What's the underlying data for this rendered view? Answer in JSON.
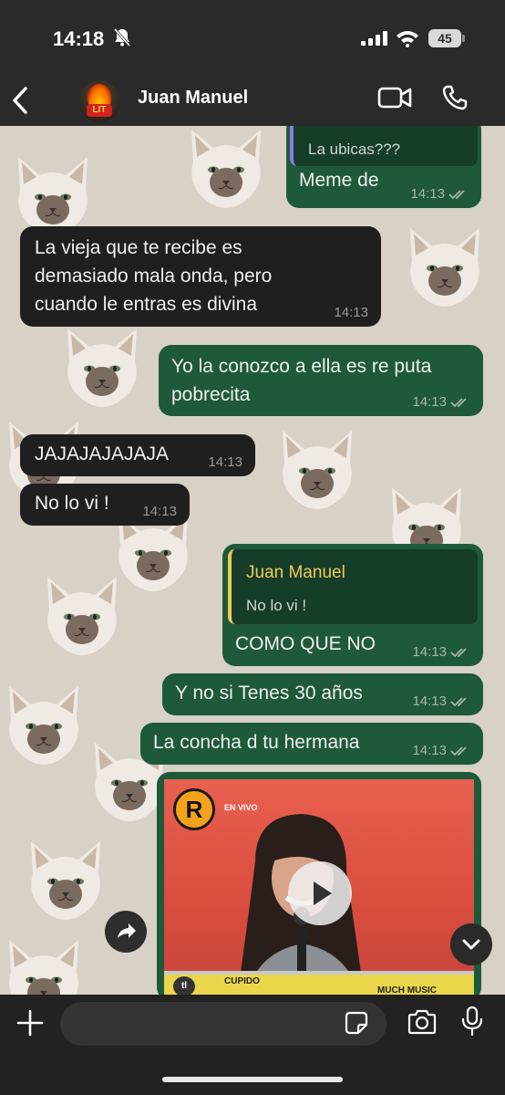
{
  "status_bar": {
    "time": "14:18",
    "battery": "45",
    "icons": [
      "bell-slash-icon",
      "signal-icon",
      "wifi-icon",
      "battery-icon"
    ]
  },
  "header": {
    "contact_name": "Juan Manuel",
    "avatar_text": "LIT",
    "icons": [
      "back-chevron-icon",
      "video-camera-icon",
      "phone-icon"
    ]
  },
  "messages": [
    {
      "id": "m1",
      "direction": "out",
      "quote_text": "La ubicas???",
      "text": "Meme de",
      "time": "14:13",
      "status": "read"
    },
    {
      "id": "m2",
      "direction": "in",
      "text_lines": [
        "La vieja que te recibe es",
        "demasiado mala onda, pero",
        "cuando le entras es divina"
      ],
      "time": "14:13"
    },
    {
      "id": "m3",
      "direction": "out",
      "text_lines": [
        "Yo la conozco a ella es re puta",
        "pobrecita"
      ],
      "time": "14:13",
      "status": "read"
    },
    {
      "id": "m4",
      "direction": "in",
      "text": "JAJAJAJAJAJA",
      "time": "14:13"
    },
    {
      "id": "m5",
      "direction": "in",
      "text": "No lo vi !",
      "time": "14:13"
    },
    {
      "id": "m6",
      "direction": "out",
      "quote_name": "Juan Manuel",
      "quote_text": "No lo vi !",
      "text": "COMO QUE NO",
      "time": "14:13",
      "status": "read"
    },
    {
      "id": "m7",
      "direction": "out",
      "text": "Y no si Tenes 30 años",
      "time": "14:13",
      "status": "read"
    },
    {
      "id": "m8",
      "direction": "out",
      "text": "La concha d tu hermana",
      "time": "14:13",
      "status": "read"
    },
    {
      "id": "m9",
      "direction": "out",
      "type": "video",
      "overlay_texts": [
        "R",
        "EN VIVO",
        "CUPIDO",
        "MUCH MUSIC",
        "tl"
      ]
    }
  ],
  "composer": {
    "placeholder": "",
    "icons": [
      "plus-icon",
      "sticker-icon",
      "camera-icon",
      "microphone-icon"
    ]
  },
  "colors": {
    "outgoing_bubble": "#1e5a3a",
    "incoming_bubble": "#1f1f1f",
    "chat_background": "#d8d1c6",
    "quote_accent": "#f0c959"
  }
}
